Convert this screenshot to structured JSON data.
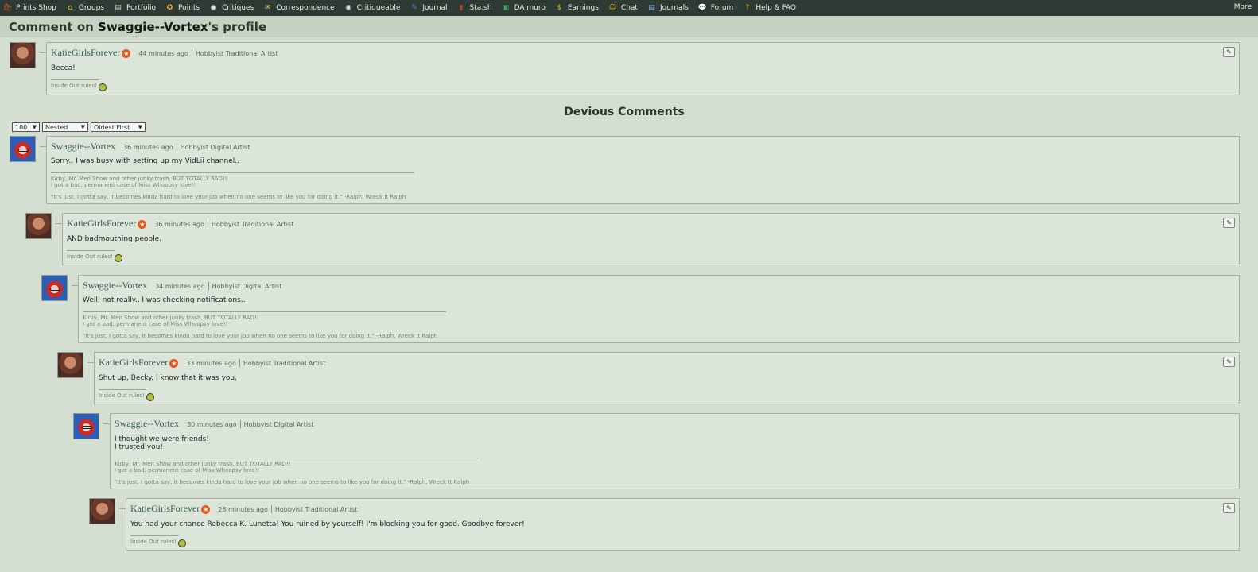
{
  "nav": {
    "items": [
      {
        "label": "Prints Shop",
        "icon": "🛍",
        "color": "#d64a2a"
      },
      {
        "label": "Groups",
        "icon": "⌂",
        "color": "#f1c40f"
      },
      {
        "label": "Portfolio",
        "icon": "▤",
        "color": "#cfd8cc"
      },
      {
        "label": "Points",
        "icon": "✪",
        "color": "#f0a830"
      },
      {
        "label": "Critiques",
        "icon": "◉",
        "color": "#e0e6df"
      },
      {
        "label": "Correspondence",
        "icon": "✉",
        "color": "#e5b96f"
      },
      {
        "label": "Critiqueable",
        "icon": "◉",
        "color": "#e0e6df"
      },
      {
        "label": "Journal",
        "icon": "✎",
        "color": "#4a8ad4"
      },
      {
        "label": "Sta.sh",
        "icon": "▮",
        "color": "#c0392b"
      },
      {
        "label": "DA muro",
        "icon": "▣",
        "color": "#3fa45b"
      },
      {
        "label": "Earnings",
        "icon": "$",
        "color": "#f1c40f"
      },
      {
        "label": "Chat",
        "icon": "☺",
        "color": "#f1c40f"
      },
      {
        "label": "Journals",
        "icon": "▤",
        "color": "#8fb8e6"
      },
      {
        "label": "Forum",
        "icon": "💬",
        "color": "#8fb8e6"
      },
      {
        "label": "Help & FAQ",
        "icon": "?",
        "color": "#f39c12"
      }
    ],
    "more": "More"
  },
  "page": {
    "title_prefix": "Comment on ",
    "owner": "Swaggie--Vortex",
    "title_suffix": "'s profile"
  },
  "section": {
    "title": "Devious Comments",
    "per_page": "100",
    "view": "Nested",
    "order": "Oldest First"
  },
  "signatures": {
    "katie": "Inside Out rules!",
    "swaggie_line1": "Kirby, Mr. Men Show and other junky trash, BUT TOTALLY RAD!!",
    "swaggie_line2": "I got a bad, permanent case of Miss Whoopsy love!!",
    "swaggie_quote": "\"It's just, I gotta say, it becomes kinda hard to love your job when no one seems to like you for doing it.\" -Ralph, Wreck It Ralph"
  },
  "comments": [
    {
      "user": "KatieGirlsForever",
      "time": "44 minutes ago",
      "role": "Hobbyist Traditional Artist",
      "body": [
        "Becca!"
      ]
    },
    {
      "user": "Swaggie--Vortex",
      "time": "36 minutes ago",
      "role": "Hobbyist Digital Artist",
      "body": [
        "Sorry.. I was busy with setting up my VidLii channel.."
      ]
    },
    {
      "user": "KatieGirlsForever",
      "time": "36 minutes ago",
      "role": "Hobbyist Traditional Artist",
      "body": [
        "AND badmouthing people."
      ]
    },
    {
      "user": "Swaggie--Vortex",
      "time": "34 minutes ago",
      "role": "Hobbyist Digital Artist",
      "body": [
        "Well, not really.. I was checking notifications.."
      ]
    },
    {
      "user": "KatieGirlsForever",
      "time": "33 minutes ago",
      "role": "Hobbyist Traditional Artist",
      "body": [
        "Shut up, Becky. I know that it was you."
      ]
    },
    {
      "user": "Swaggie--Vortex",
      "time": "30 minutes ago",
      "role": "Hobbyist Digital Artist",
      "body": [
        "I thought we were friends!",
        "I trusted you!"
      ]
    },
    {
      "user": "KatieGirlsForever",
      "time": "28 minutes ago",
      "role": "Hobbyist Traditional Artist",
      "body": [
        "You had your chance Rebecca K. Lunetta! You ruined by yourself! I'm blocking you for good. Goodbye forever!"
      ]
    }
  ]
}
